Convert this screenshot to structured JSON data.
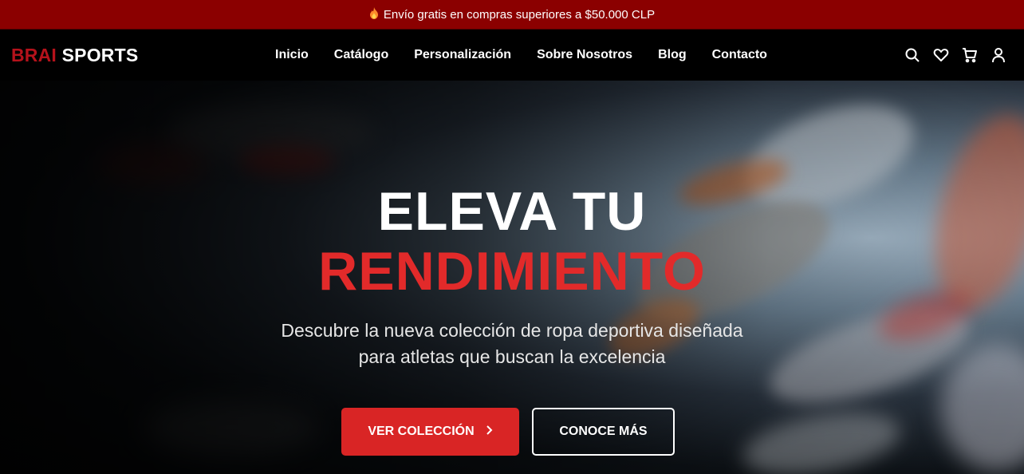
{
  "promo": {
    "icon": "flame-icon",
    "text": "Envío gratis en compras superiores a $50.000 CLP"
  },
  "brand": {
    "part1": "BRAI",
    "part2": "SPORTS",
    "accent_color": "#b5121b"
  },
  "nav": {
    "links": [
      "Inicio",
      "Catálogo",
      "Personalización",
      "Sobre Nosotros",
      "Blog",
      "Contacto"
    ],
    "icons": [
      "search-icon",
      "heart-icon",
      "cart-icon",
      "user-icon"
    ]
  },
  "hero": {
    "title_line1": "ELEVA TU",
    "title_line2": "RENDIMIENTO",
    "subtitle_line1": "Descubre la nueva colección de ropa deportiva diseñada",
    "subtitle_line2": "para atletas que buscan la excelencia",
    "primary_button": "VER COLECCIÓN",
    "secondary_button": "CONOCE MÁS",
    "accent_color": "#e22a2a"
  }
}
